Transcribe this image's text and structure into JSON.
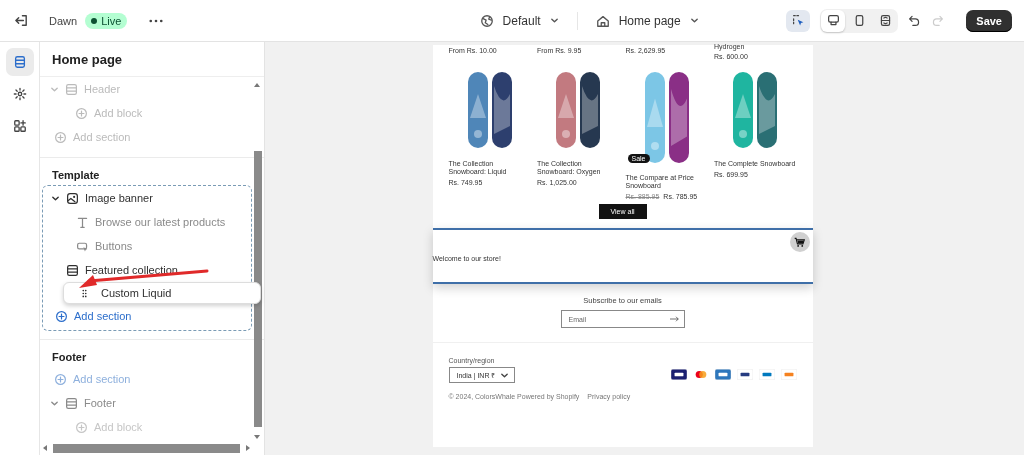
{
  "topbar": {
    "theme": "Dawn",
    "status": "Live",
    "template": "Default",
    "page": "Home page",
    "save": "Save",
    "inspector_selected": true,
    "devices": [
      {
        "kind": "desktop",
        "selected": true
      },
      {
        "kind": "mobile",
        "selected": false
      },
      {
        "kind": "full",
        "selected": false
      }
    ],
    "undo_disabled": false,
    "redo_disabled": true
  },
  "rail": [
    {
      "kind": "sections",
      "selected": true
    },
    {
      "kind": "settings",
      "selected": false
    },
    {
      "kind": "apps",
      "selected": false
    }
  ],
  "sidebar": {
    "title": "Home page",
    "groups": [
      {
        "items": [
          {
            "kind": "section",
            "label": "Header",
            "disabled": true,
            "children": [
              {
                "kind": "add-block",
                "label": "Add block",
                "disabled": true
              }
            ]
          },
          {
            "kind": "add-section",
            "label": "Add section",
            "disabled": true
          }
        ]
      },
      {
        "title": "Template",
        "items": [
          {
            "kind": "section",
            "label": "Image banner",
            "disabled": false,
            "children": [
              {
                "kind": "text-block",
                "label": "Browse our latest products",
                "disabled": true
              },
              {
                "kind": "buttons-block",
                "label": "Buttons",
                "disabled": true
              }
            ]
          },
          {
            "kind": "section",
            "label": "Featured collection",
            "disabled": false
          },
          {
            "kind": "dragging",
            "label": "Custom Liquid",
            "disabled": false
          },
          {
            "kind": "add-section",
            "label": "Add section",
            "disabled": false
          }
        ]
      },
      {
        "title": "Footer",
        "items": [
          {
            "kind": "add-section",
            "label": "Add section",
            "disabled": true
          },
          {
            "kind": "section",
            "label": "Footer",
            "disabled": true,
            "children": [
              {
                "kind": "add-block",
                "label": "Add block",
                "disabled": true
              }
            ]
          }
        ]
      }
    ]
  },
  "preview": {
    "top_row": [
      {
        "price": "From Rs. 10.00"
      },
      {
        "price": "From Rs. 9.95"
      },
      {
        "price": "Rs. 2,629.95"
      },
      {
        "name": "Hydrogen",
        "price": "Rs. 600.00"
      }
    ],
    "products": [
      {
        "name": "The Collection Snowboard: Liquid",
        "price": "Rs. 749.95",
        "sale": false
      },
      {
        "name": "The Collection Snowboard: Oxygen",
        "price": "Rs. 1,025.00",
        "sale": false
      },
      {
        "name": "The Compare at Price Snowboard",
        "price": "Rs. 785.95",
        "compare_price": "Rs. 885.95",
        "sale": true,
        "badge": "Sale"
      },
      {
        "name": "The Complete Snowboard",
        "price": "Rs. 699.95",
        "sale": false
      }
    ],
    "view_all": "View all",
    "custom_liquid": "Welcome to our store!",
    "subscribe_title": "Subscribe to our emails",
    "email_placeholder": "Email",
    "country_label": "Country/region",
    "country_value": "India | INR ₹",
    "copyright": "© 2024, ColorsWhale Powered by Shopify",
    "privacy": "Privacy policy"
  }
}
